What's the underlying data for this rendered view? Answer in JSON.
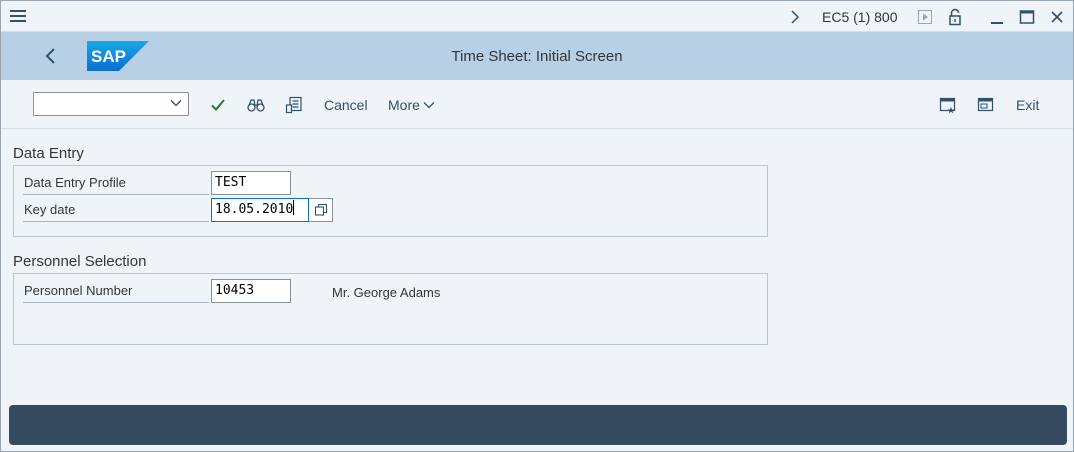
{
  "system": {
    "info": "EC5 (1) 800"
  },
  "header": {
    "title": "Time Sheet: Initial Screen",
    "logo": "SAP"
  },
  "toolbar": {
    "command_field_value": "",
    "cancel_label": "Cancel",
    "more_label": "More",
    "exit_label": "Exit"
  },
  "data_entry": {
    "title": "Data Entry",
    "profile_label": "Data Entry Profile",
    "profile_value": "TEST",
    "key_date_label": "Key date",
    "key_date_value": "18.05.2010"
  },
  "personnel": {
    "title": "Personnel Selection",
    "number_label": "Personnel Number",
    "number_value": "10453",
    "name": "Mr. George Adams"
  },
  "colors": {
    "header_bg": "#b7d0e6",
    "page_bg": "#eff4f9",
    "footer_bg": "#354a5f",
    "accent": "#0a6ed1",
    "check": "#2b7c2b"
  },
  "icons": [
    "menu-icon",
    "chevron-right-icon",
    "play-icon",
    "lock-icon",
    "minimize-icon",
    "maximize-icon",
    "close-icon",
    "back-icon",
    "checkmark-icon",
    "binoculars-icon",
    "layout-icon",
    "new-session-icon",
    "session-icon",
    "f4-help-icon"
  ]
}
